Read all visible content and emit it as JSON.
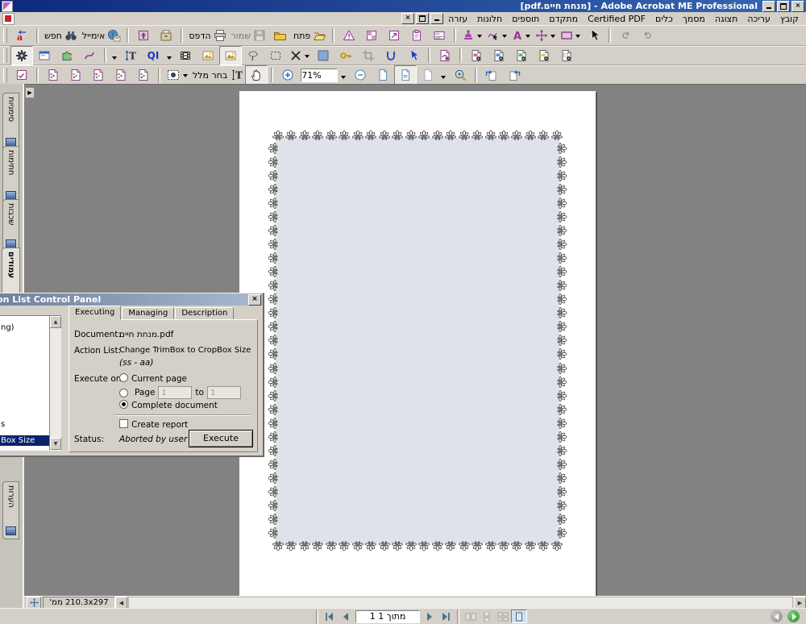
{
  "titlebar": {
    "title": "[pdf.מנחת חיים] - Adobe Acrobat ME Professional"
  },
  "menubar": {
    "items": [
      "קובץ",
      "עריכה",
      "תצוגה",
      "מסמך",
      "כלים",
      "Certified PDF",
      "מתקדם",
      "תוספים",
      "חלונות",
      "עזרה"
    ]
  },
  "toolbar1": {
    "open": "פתח",
    "save": "שמור",
    "print": "הדפס",
    "email": "אימייל",
    "search": "חפש"
  },
  "toolbar2": {
    "qi": "QI"
  },
  "toolbar3": {
    "select_text": "בחר מלל",
    "zoom_value": "71%"
  },
  "sidebar": {
    "tabs": [
      "סימניות",
      "חתימות",
      "שכבות",
      "עמודים",
      "הערות"
    ]
  },
  "docpane": {
    "page_size": "210.3x297 ממ'"
  },
  "navbar": {
    "page_indicator": "1 מתוך 1"
  },
  "dialog": {
    "title": "Action List Control Panel",
    "tabs": [
      "Executing",
      "Managing",
      "Description"
    ],
    "list": [
      "ng)",
      "s",
      "Box Size"
    ],
    "document_label": "Document:",
    "document_value": "מנחת חיים.pdf",
    "action_list_label": "Action List:",
    "action_list_value": "Change TrimBox to CropBox Size",
    "action_list_sub": "(ss - aa)",
    "execute_on_label": "Execute on:",
    "radio_current": "Current page",
    "radio_page": "Page",
    "page_from": "1",
    "to_label": "to",
    "page_to": "1",
    "radio_complete": "Complete document",
    "create_report": "Create report",
    "status_label": "Status:",
    "status_value": "Aborted by user",
    "execute_button": "Execute"
  },
  "colors": {
    "titlebar_left": "#0e2a7c",
    "titlebar_right": "#3767b1",
    "chrome": "#d4d0c8",
    "doc_background": "#828282",
    "page_interior": "#dde3e8",
    "selection": "#0a246a",
    "accent_purple": "#993399",
    "next_view_green": "#2e9e3a"
  }
}
